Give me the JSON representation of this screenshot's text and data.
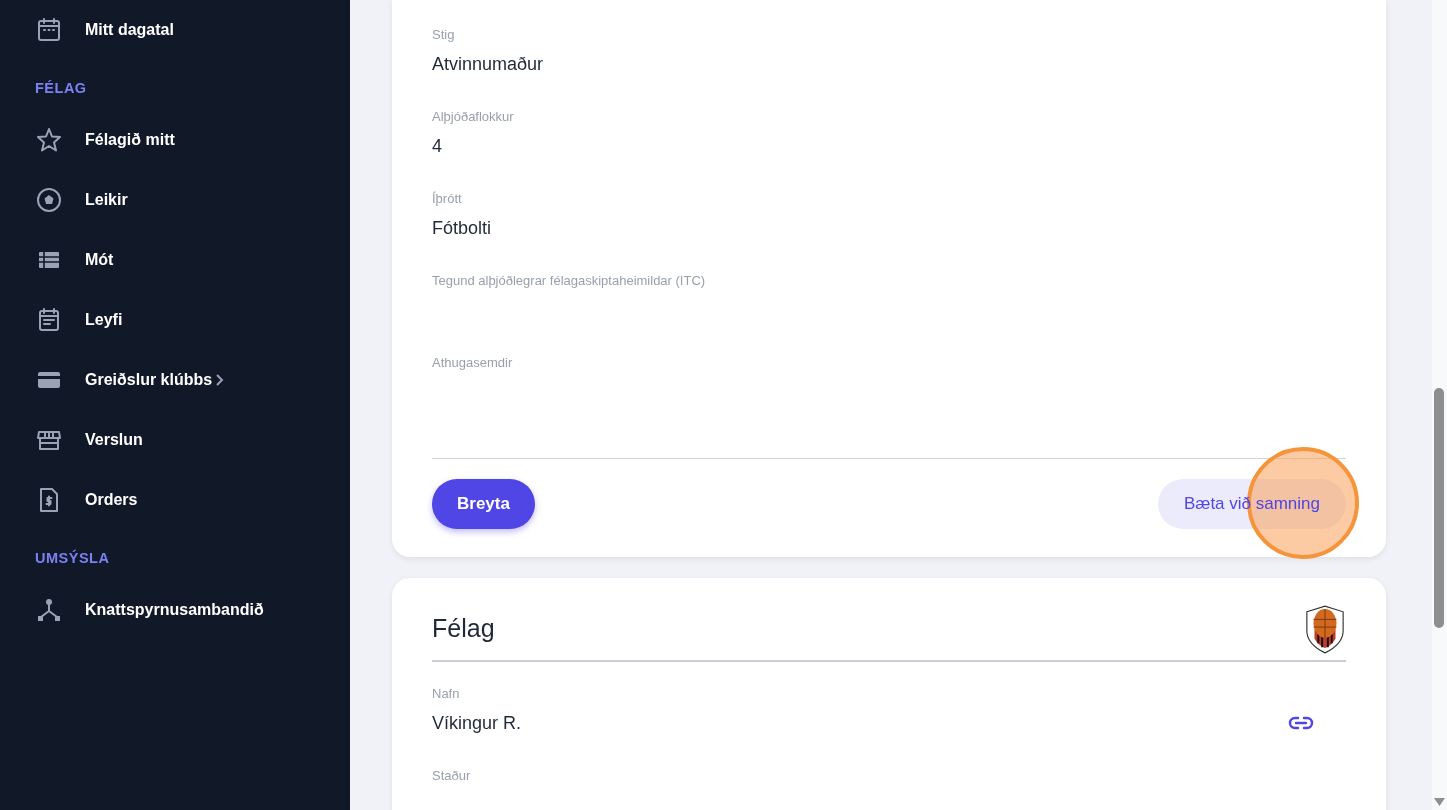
{
  "sidebar": {
    "sections": [
      {
        "items": [
          {
            "label": "Mitt dagatal",
            "submenu": false
          }
        ]
      },
      {
        "title": "FÉLAG",
        "items": [
          {
            "label": "Félagið mitt",
            "submenu": false
          },
          {
            "label": "Leikir",
            "submenu": false
          },
          {
            "label": "Mót",
            "submenu": false
          },
          {
            "label": "Leyfi",
            "submenu": false
          },
          {
            "label": "Greiðslur klúbbs",
            "submenu": true
          },
          {
            "label": "Verslun",
            "submenu": false
          },
          {
            "label": "Orders",
            "submenu": false
          }
        ]
      },
      {
        "title": "UMSÝSLA",
        "items": [
          {
            "label": "Knattspyrnusambandið",
            "submenu": false
          }
        ]
      }
    ]
  },
  "contract_card": {
    "fields": [
      {
        "label": "Stig",
        "value": "Atvinnumaður"
      },
      {
        "label": "Alþjóðaflokkur",
        "value": "4"
      },
      {
        "label": "Íþrótt",
        "value": "Fótbolti"
      },
      {
        "label": "Tegund alþjóðlegrar félagaskiptaheimildar (ITC)"
      },
      {
        "label": "Athugasemdir"
      }
    ],
    "buttons": [
      {
        "label": "Breyta",
        "kind": "primary",
        "clicked": false
      },
      {
        "label": "Bæta við samning",
        "kind": "soft",
        "clicked": true
      }
    ]
  },
  "club_card": {
    "title": "Félag",
    "fields": [
      {
        "label": "Nafn",
        "value": "Víkingur R.",
        "link": true
      },
      {
        "label": "Staður"
      }
    ]
  }
}
